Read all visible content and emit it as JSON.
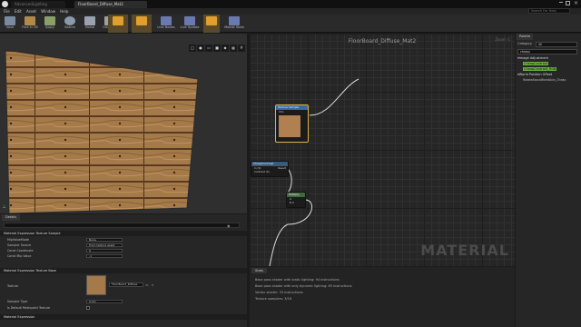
{
  "window": {
    "tabs": [
      "AdvancedLighting",
      "FloorBoard_Diffuse_Mat2"
    ],
    "search_help_placeholder": "Search For Help"
  },
  "menu": [
    "File",
    "Edit",
    "Asset",
    "Window",
    "Help"
  ],
  "toolbar": [
    {
      "label": "Save",
      "icon": "save-icon"
    },
    {
      "label": "Find in CB",
      "icon": "find-in-cb-icon"
    },
    {
      "label": "Apply",
      "icon": "apply-icon"
    },
    {
      "label": "Search",
      "icon": "search-icon"
    },
    {
      "label": "Home",
      "icon": "home-icon"
    },
    {
      "label": "Clean Up",
      "icon": "clean-up-icon"
    },
    {
      "label": "",
      "icon": "connectors-icon"
    },
    {
      "label": "",
      "icon": "live-preview-icon"
    },
    {
      "label": "Live Nodes",
      "icon": "live-nodes-icon"
    },
    {
      "label": "Live Update",
      "icon": "live-update-icon"
    },
    {
      "label": "",
      "icon": "hide-unused-icon"
    },
    {
      "label": "Mobile Stats",
      "icon": "mobile-stats-icon"
    }
  ],
  "graph": {
    "title": "FloorBoard_Diffuse_Mat2",
    "zoom": "Zoom -1",
    "watermark": "MATERIAL",
    "nodes": {
      "texture_sample": {
        "title": "Texture Sample",
        "pin": "UVs"
      },
      "cheap_contrast": {
        "title": "CheapContrast",
        "pins": [
          "In (S)",
          "Contrast (S)"
        ],
        "output": "Result"
      },
      "multiply": {
        "title": "Multiply",
        "pins": [
          "A",
          "B"
        ],
        "b_value": "0"
      }
    }
  },
  "details": {
    "tab": "Details",
    "sections": [
      {
        "header": "Material Expression Texture Sample",
        "rows": [
          {
            "label": "MipValueMode",
            "value": "None"
          },
          {
            "label": "Sampler Source",
            "value": "From texture asset"
          },
          {
            "label": "Const Coordinate",
            "value": "0"
          },
          {
            "label": "Const Mip Value",
            "value": "-1"
          }
        ]
      },
      {
        "header": "Material Expression Texture Base",
        "rows": [
          {
            "label": "Texture",
            "value": "FloorBoard_Diffuse"
          },
          {
            "label": "Sampler Type",
            "value": "Color"
          },
          {
            "label": "Is Default Meshpaint Texture",
            "value": ""
          }
        ]
      },
      {
        "header": "Material Expression",
        "rows": []
      }
    ]
  },
  "stats": {
    "tab": "Stats",
    "lines": [
      "Base pass shader with static lighting: 94 instructions",
      "Base pass shader with only dynamic lighting: 63 instructions",
      "Vertex shader: 33 instructions",
      "Texture samplers: 3/16"
    ]
  },
  "palette": {
    "tab": "Palette",
    "category_label": "Category",
    "category_value": "All",
    "search_value": "cheap",
    "items": [
      {
        "text": "Image Adjustment",
        "type": "header"
      },
      {
        "text": "CheapContrast",
        "type": "match"
      },
      {
        "text": "CheapContrast_RGB",
        "type": "match"
      },
      {
        "text": "World Position Offset",
        "type": "header"
      },
      {
        "text": "RotateAboutWorldAxis_Cheap",
        "type": "match"
      }
    ]
  }
}
